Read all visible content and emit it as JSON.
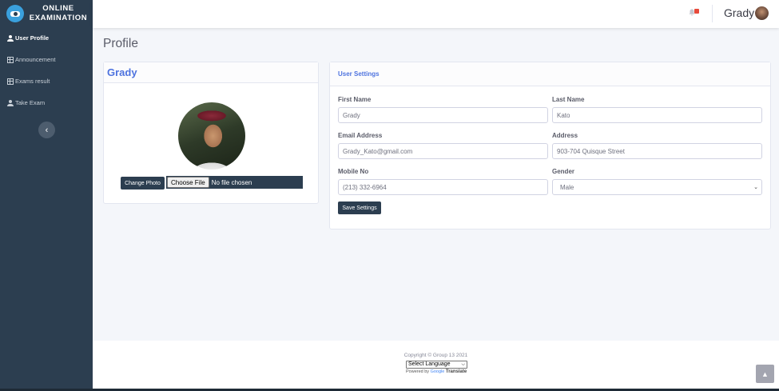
{
  "brand": {
    "line1": "ONLINE",
    "line2": "EXAMINATION"
  },
  "sidebar": {
    "items": [
      {
        "label": "User Profile",
        "icon": "user-icon",
        "active": true
      },
      {
        "label": "Announcement",
        "icon": "table-icon",
        "active": false
      },
      {
        "label": "Exams result",
        "icon": "table-icon",
        "active": false
      },
      {
        "label": "Take Exam",
        "icon": "user-icon",
        "active": false
      }
    ],
    "toggle_glyph": "‹"
  },
  "topbar": {
    "user_name": "Grady",
    "alert_icon": "bell-icon"
  },
  "page": {
    "title": "Profile"
  },
  "profile_card": {
    "name": "Grady",
    "change_photo_label": "Change Photo",
    "file_button_label": "Choose File",
    "file_status": "No file chosen"
  },
  "settings": {
    "header": "User Settings",
    "first_name_label": "First Name",
    "first_name_value": "Grady",
    "last_name_label": "Last Name",
    "last_name_value": "Kato",
    "email_label": "Email Address",
    "email_value": "Grady_Kato@gmail.com",
    "address_label": "Address",
    "address_value": "903-704 Quisque Street",
    "mobile_label": "Mobile No",
    "mobile_value": "(213) 332-6964",
    "gender_label": "Gender",
    "gender_value": "Male",
    "save_label": "Save Settings"
  },
  "footer": {
    "copyright": "Copyright © Group 13 2021",
    "language_select": "Select Language",
    "powered_by": "Powered by",
    "google": "Google",
    "translate": "Translate"
  },
  "colors": {
    "sidebar": "#2c3e50",
    "accent": "#4e73df",
    "button": "#2c3e50",
    "alert": "#e74a3b"
  }
}
